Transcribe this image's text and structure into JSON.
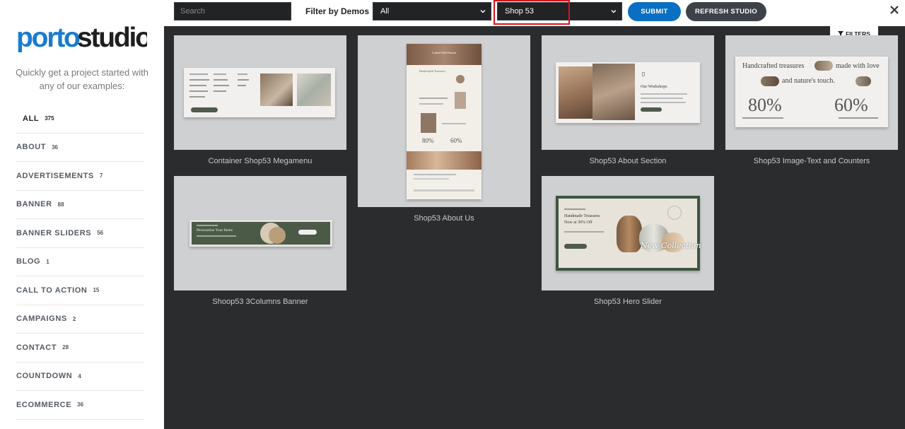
{
  "sidebar": {
    "logo_part1": "porto",
    "logo_part2": "studio",
    "tagline": "Quickly get a project started with any of our examples:",
    "categories": [
      {
        "name": "ALL",
        "count": "375"
      },
      {
        "name": "ABOUT",
        "count": "36"
      },
      {
        "name": "ADVERTISEMENTS",
        "count": "7"
      },
      {
        "name": "BANNER",
        "count": "88"
      },
      {
        "name": "BANNER SLIDERS",
        "count": "56"
      },
      {
        "name": "BLOG",
        "count": "1"
      },
      {
        "name": "CALL TO ACTION",
        "count": "15"
      },
      {
        "name": "CAMPAIGNS",
        "count": "2"
      },
      {
        "name": "CONTACT",
        "count": "28"
      },
      {
        "name": "COUNTDOWN",
        "count": "4"
      },
      {
        "name": "ECOMMERCE",
        "count": "36"
      }
    ]
  },
  "toolbar": {
    "search_placeholder": "Search",
    "filter_label": "Filter by Demos",
    "select1_value": "All",
    "select2_value": "Shop 53",
    "submit_label": "SUBMIT",
    "refresh_label": "REFRESH STUDIO",
    "filters_label": "FILTERS"
  },
  "cards": [
    {
      "title": "Container Shop53 Megamenu"
    },
    {
      "title": "Shop53 About Us"
    },
    {
      "title": "Shop53 About Section"
    },
    {
      "title": "Shop53 Image-Text and Counters"
    },
    {
      "title": "Shoop53 3Columns Banner"
    },
    {
      "title": "Shop53 Hero Slider"
    }
  ],
  "thumb_text": {
    "about_us_heading": "Crafted With Passion",
    "about_us_hand": "Handcrafted Treasures",
    "workshops": "Our Workshops",
    "counters_line1": "Handcrafted treasures",
    "counters_line1b": "made with love",
    "counters_line2": "and nature's touch.",
    "counter1": "80%",
    "counter2": "60%",
    "banner_text": "Personalize Your Items",
    "hero_line1": "Handmade Treasures",
    "hero_line2": "Now at 30% Off",
    "hero_script": "New Collection"
  },
  "colors": {
    "accent_blue": "#0a6fc2",
    "logo_blue": "#1a7bd0",
    "logo_dark": "#1f1f1f",
    "highlight_red": "#d8131a"
  }
}
